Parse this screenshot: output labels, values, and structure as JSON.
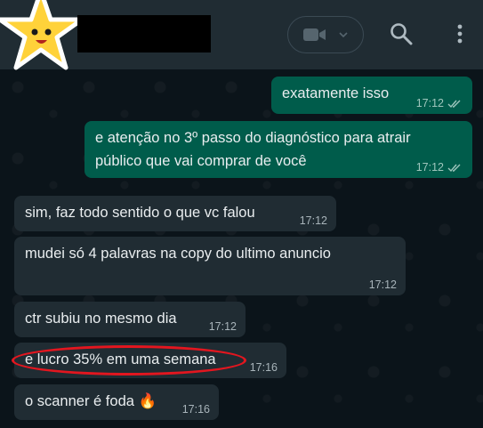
{
  "messages": [
    {
      "dir": "out",
      "text": "exatamente isso",
      "time": "17:12"
    },
    {
      "dir": "out",
      "text": "e atenção no 3º passo do diagnóstico para atrair público que vai comprar de você",
      "time": "17:12"
    },
    {
      "dir": "in",
      "text": "sim, faz todo sentido o que vc falou",
      "time": "17:12"
    },
    {
      "dir": "in",
      "text": "mudei só 4 palavras na copy do ultimo anuncio",
      "time": "17:12"
    },
    {
      "dir": "in",
      "text": "ctr subiu no mesmo dia",
      "time": "17:12"
    },
    {
      "dir": "in",
      "text": "e lucro 35% em uma semana",
      "time": "17:16"
    },
    {
      "dir": "in",
      "text": "o scanner é foda 🔥",
      "time": "17:16"
    }
  ],
  "colors": {
    "outgoing": "#005c4b",
    "incoming": "#202c33",
    "highlight": "#e3161f"
  },
  "icons": [
    "star-avatar-icon",
    "video-call-icon",
    "chevron-down-icon",
    "search-icon",
    "menu-dots-icon",
    "double-check-icon"
  ]
}
